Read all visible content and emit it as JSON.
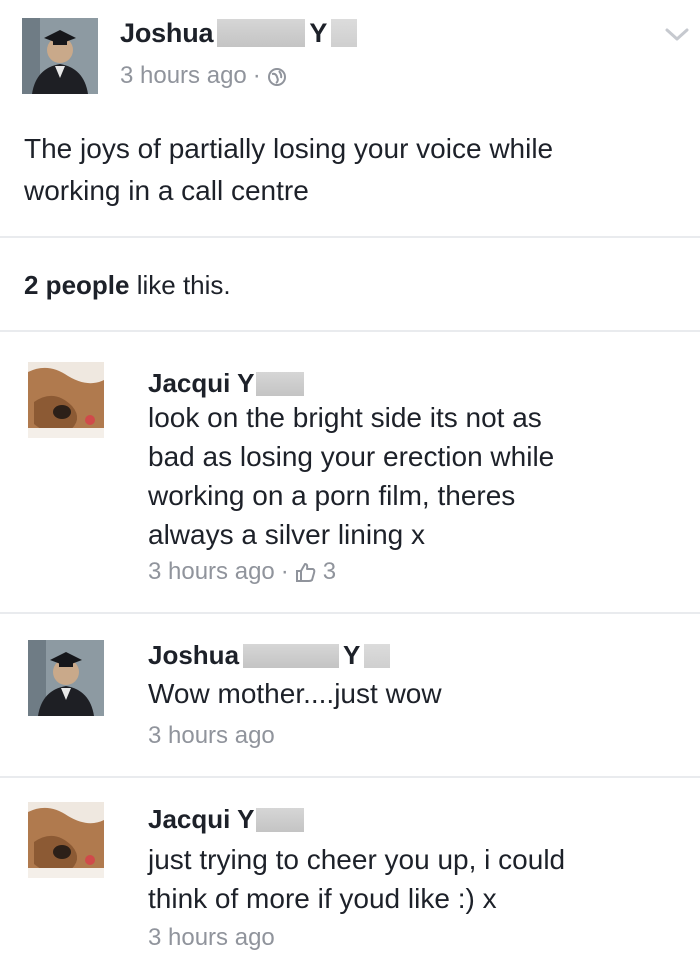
{
  "post": {
    "author_first": "Joshua",
    "author_initial": "Y",
    "timestamp": "3 hours ago",
    "separator": "·",
    "privacy_icon": "globe-icon",
    "menu_icon": "chevron-down-icon",
    "status_line1": "The joys of partially losing your voice while",
    "status_line2": "working in a call centre"
  },
  "likes": {
    "count_text": "2 people",
    "suffix": " like this."
  },
  "comments": [
    {
      "author": "Jacqui Y",
      "lines": [
        "look on the bright side its not as",
        "bad as losing your erection while",
        "working on a porn film, theres",
        "always a silver lining x"
      ],
      "timestamp": "3 hours ago",
      "separator": "·",
      "like_icon": "thumbs-up-icon",
      "like_count": "3"
    },
    {
      "author_first": "Joshua",
      "author_initial": "Y",
      "text": "Wow mother....just wow",
      "timestamp": "3 hours ago"
    },
    {
      "author": "Jacqui Y",
      "lines": [
        "just trying to cheer you up, i could",
        "think of more if youd like :) x"
      ],
      "timestamp": "3 hours ago"
    }
  ]
}
